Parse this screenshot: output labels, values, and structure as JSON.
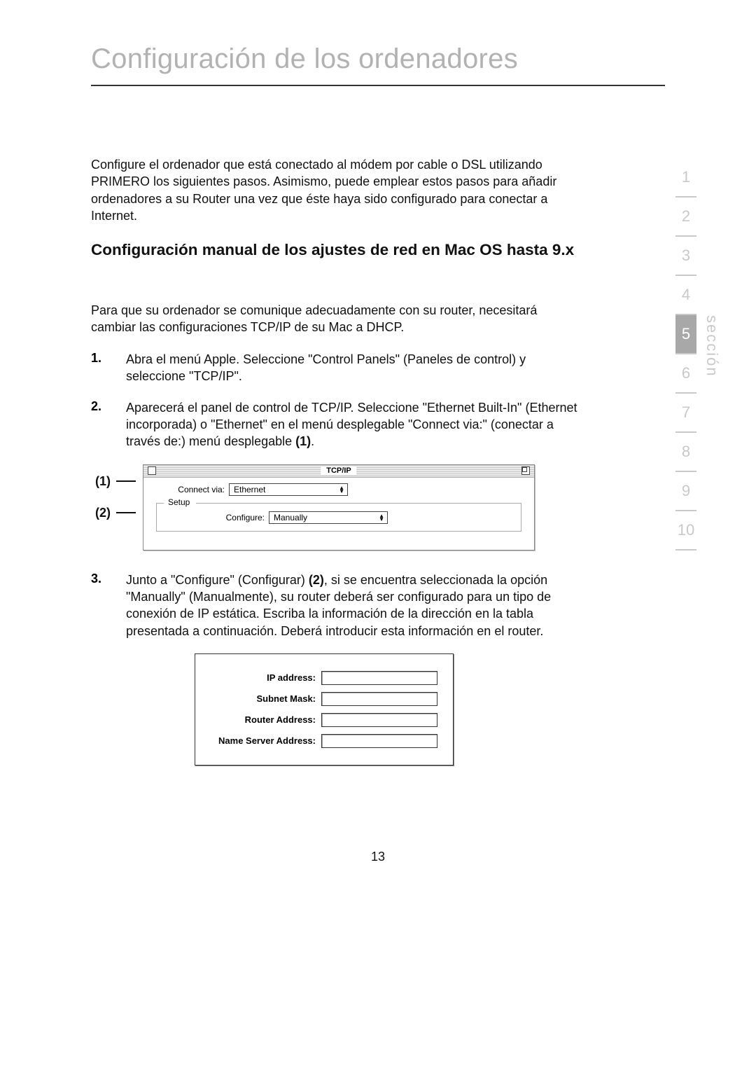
{
  "title": "Configuración de los ordenadores",
  "intro": "Configure el ordenador que está conectado al módem por cable o DSL utilizando PRIMERO los siguientes pasos. Asimismo, puede emplear estos pasos para añadir ordenadores a su Router una vez que éste haya sido configurado para conectar a Internet.",
  "subheading": "Configuración manual de los ajustes de red en Mac OS hasta 9.x",
  "lead": "Para que su ordenador se comunique adecuadamente con su router, necesitará cambiar las configuraciones TCP/IP de su Mac a DHCP.",
  "steps": {
    "n1": "1.",
    "s1": "Abra el menú Apple. Seleccione \"Control Panels\" (Paneles de control) y seleccione \"TCP/IP\".",
    "n2": "2.",
    "s2_pre": "Aparecerá el panel de control de TCP/IP. Seleccione \"Ethernet Built-In\" (Ethernet incorporada) o \"Ethernet\" en el menú desplegable \"Connect via:\" (conectar a través de:) menú desplegable ",
    "s2_bold": "(1)",
    "s2_post": ".",
    "n3": "3.",
    "s3_pre": "Junto a \"Configure\" (Configurar) ",
    "s3_bold": "(2)",
    "s3_post": ", si se encuentra seleccionada la opción \"Manually\" (Manualmente), su router deberá ser configurado para un tipo de conexión de IP estática. Escriba la información de la dirección en la tabla presentada a continuación. Deberá introducir esta información en el router."
  },
  "callout1": "(1)",
  "callout2": "(2)",
  "panel": {
    "title": "TCP/IP",
    "connect_label": "Connect via:",
    "connect_value": "Ethernet",
    "setup_legend": "Setup",
    "configure_label": "Configure:",
    "configure_value": "Manually"
  },
  "ip_table": {
    "ip": "IP address:",
    "subnet": "Subnet Mask:",
    "router": "Router Address:",
    "dns": "Name Server Address:"
  },
  "nav": {
    "items": [
      "1",
      "2",
      "3",
      "4",
      "5",
      "6",
      "7",
      "8",
      "9",
      "10"
    ],
    "active": "5",
    "vertical_label": "sección"
  },
  "page_number": "13"
}
